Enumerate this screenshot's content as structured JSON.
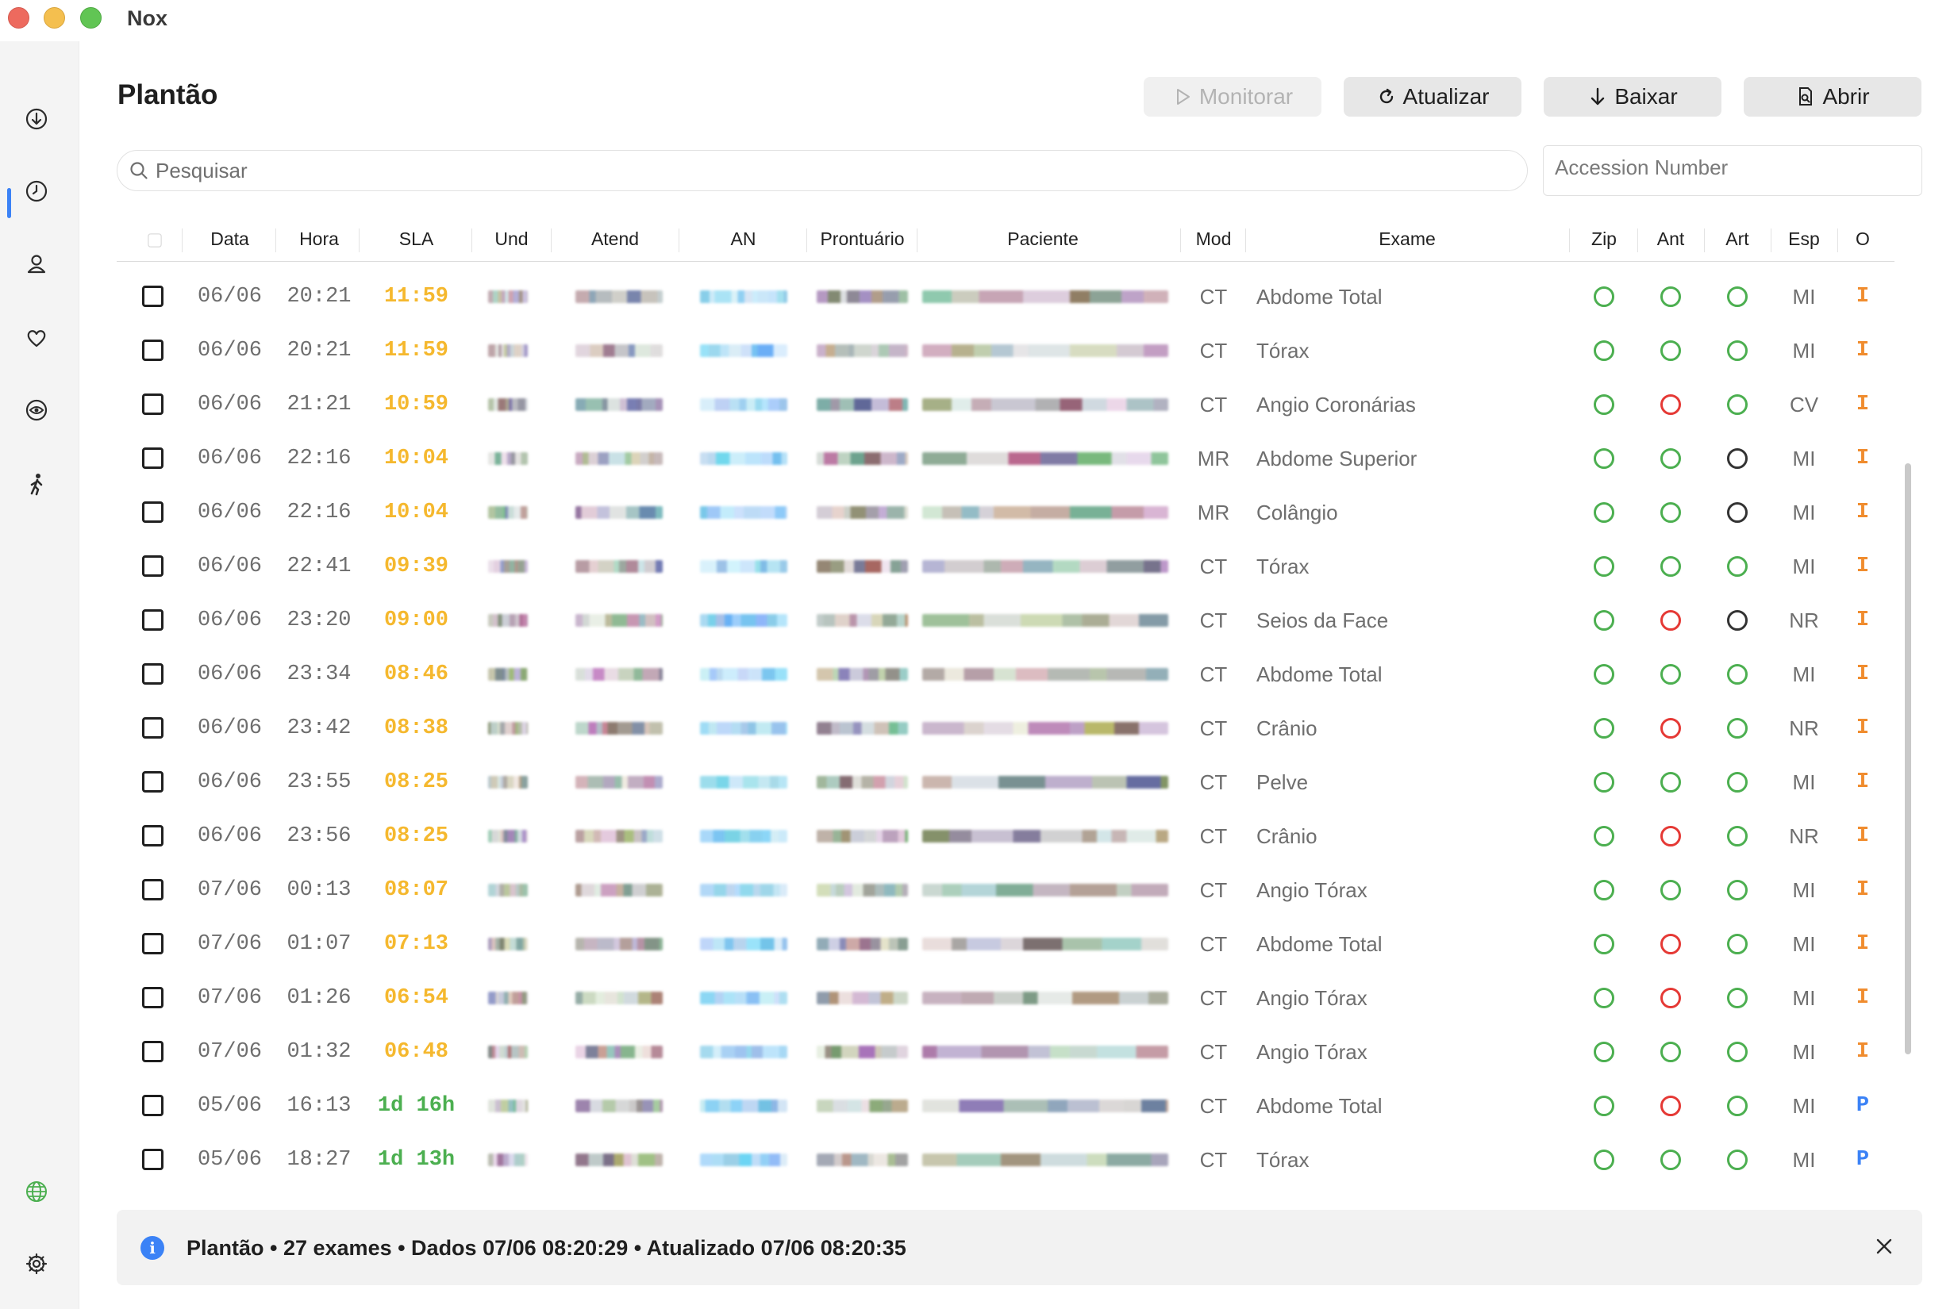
{
  "window": {
    "title": "Nox"
  },
  "sidebar": {
    "items": [
      {
        "icon": "download-icon"
      },
      {
        "icon": "clock-icon",
        "active": true
      },
      {
        "icon": "user-icon"
      },
      {
        "icon": "heart-icon"
      },
      {
        "icon": "eye-icon"
      },
      {
        "icon": "walking-icon"
      }
    ],
    "bottom": [
      {
        "icon": "globe-icon"
      },
      {
        "icon": "gear-icon"
      }
    ]
  },
  "header": {
    "title": "Plantão",
    "buttons": {
      "monitor": "Monitorar",
      "refresh": "Atualizar",
      "download": "Baixar",
      "open": "Abrir"
    }
  },
  "search": {
    "placeholder": "Pesquisar",
    "value": ""
  },
  "accession": {
    "placeholder": "Accession Number",
    "value": ""
  },
  "table": {
    "columns": [
      "Data",
      "Hora",
      "SLA",
      "Und",
      "Atend",
      "AN",
      "Prontuário",
      "Paciente",
      "Mod",
      "Exame",
      "Zip",
      "Ant",
      "Art",
      "Esp",
      "O"
    ],
    "rows": [
      {
        "data": "06/06",
        "hora": "20:21",
        "sla": "11:59",
        "sla_status": "warn",
        "mod": "CT",
        "exame": "Abdome Total",
        "zip": "green",
        "ant": "green",
        "art": "green",
        "esp": "MI",
        "o": "I"
      },
      {
        "data": "06/06",
        "hora": "20:21",
        "sla": "11:59",
        "sla_status": "warn",
        "mod": "CT",
        "exame": "Tórax",
        "zip": "green",
        "ant": "green",
        "art": "green",
        "esp": "MI",
        "o": "I"
      },
      {
        "data": "06/06",
        "hora": "21:21",
        "sla": "10:59",
        "sla_status": "warn",
        "mod": "CT",
        "exame": "Angio Coronárias",
        "zip": "green",
        "ant": "red",
        "art": "green",
        "esp": "CV",
        "o": "I"
      },
      {
        "data": "06/06",
        "hora": "22:16",
        "sla": "10:04",
        "sla_status": "warn",
        "mod": "MR",
        "exame": "Abdome Superior",
        "zip": "green",
        "ant": "green",
        "art": "dark",
        "esp": "MI",
        "o": "I"
      },
      {
        "data": "06/06",
        "hora": "22:16",
        "sla": "10:04",
        "sla_status": "warn",
        "mod": "MR",
        "exame": "Colângio",
        "zip": "green",
        "ant": "green",
        "art": "dark",
        "esp": "MI",
        "o": "I"
      },
      {
        "data": "06/06",
        "hora": "22:41",
        "sla": "09:39",
        "sla_status": "warn",
        "mod": "CT",
        "exame": "Tórax",
        "zip": "green",
        "ant": "green",
        "art": "green",
        "esp": "MI",
        "o": "I"
      },
      {
        "data": "06/06",
        "hora": "23:20",
        "sla": "09:00",
        "sla_status": "warn",
        "mod": "CT",
        "exame": "Seios da Face",
        "zip": "green",
        "ant": "red",
        "art": "dark",
        "esp": "NR",
        "o": "I"
      },
      {
        "data": "06/06",
        "hora": "23:34",
        "sla": "08:46",
        "sla_status": "warn",
        "mod": "CT",
        "exame": "Abdome Total",
        "zip": "green",
        "ant": "green",
        "art": "green",
        "esp": "MI",
        "o": "I"
      },
      {
        "data": "06/06",
        "hora": "23:42",
        "sla": "08:38",
        "sla_status": "warn",
        "mod": "CT",
        "exame": "Crânio",
        "zip": "green",
        "ant": "red",
        "art": "green",
        "esp": "NR",
        "o": "I"
      },
      {
        "data": "06/06",
        "hora": "23:55",
        "sla": "08:25",
        "sla_status": "warn",
        "mod": "CT",
        "exame": "Pelve",
        "zip": "green",
        "ant": "green",
        "art": "green",
        "esp": "MI",
        "o": "I"
      },
      {
        "data": "06/06",
        "hora": "23:56",
        "sla": "08:25",
        "sla_status": "warn",
        "mod": "CT",
        "exame": "Crânio",
        "zip": "green",
        "ant": "red",
        "art": "green",
        "esp": "NR",
        "o": "I"
      },
      {
        "data": "07/06",
        "hora": "00:13",
        "sla": "08:07",
        "sla_status": "warn",
        "mod": "CT",
        "exame": "Angio Tórax",
        "zip": "green",
        "ant": "green",
        "art": "green",
        "esp": "MI",
        "o": "I"
      },
      {
        "data": "07/06",
        "hora": "01:07",
        "sla": "07:13",
        "sla_status": "warn",
        "mod": "CT",
        "exame": "Abdome Total",
        "zip": "green",
        "ant": "red",
        "art": "green",
        "esp": "MI",
        "o": "I"
      },
      {
        "data": "07/06",
        "hora": "01:26",
        "sla": "06:54",
        "sla_status": "warn",
        "mod": "CT",
        "exame": "Angio Tórax",
        "zip": "green",
        "ant": "red",
        "art": "green",
        "esp": "MI",
        "o": "I"
      },
      {
        "data": "07/06",
        "hora": "01:32",
        "sla": "06:48",
        "sla_status": "warn",
        "mod": "CT",
        "exame": "Angio Tórax",
        "zip": "green",
        "ant": "green",
        "art": "green",
        "esp": "MI",
        "o": "I"
      },
      {
        "data": "05/06",
        "hora": "16:13",
        "sla": "1d 16h",
        "sla_status": "ok",
        "mod": "CT",
        "exame": "Abdome Total",
        "zip": "green",
        "ant": "red",
        "art": "green",
        "esp": "MI",
        "o": "P"
      },
      {
        "data": "05/06",
        "hora": "18:27",
        "sla": "1d 13h",
        "sla_status": "ok",
        "mod": "CT",
        "exame": "Tórax",
        "zip": "green",
        "ant": "green",
        "art": "green",
        "esp": "MI",
        "o": "P"
      }
    ]
  },
  "status": {
    "text": "Plantão • 27 exames • Dados 07/06 08:20:29 • Atualizado 07/06 08:20:35"
  },
  "colors": {
    "sla_warn": "#f5b82e",
    "sla_ok": "#4caf50",
    "origin_I": "#f08c2e",
    "origin_P": "#3b82f6",
    "accent": "#3b82f6"
  }
}
